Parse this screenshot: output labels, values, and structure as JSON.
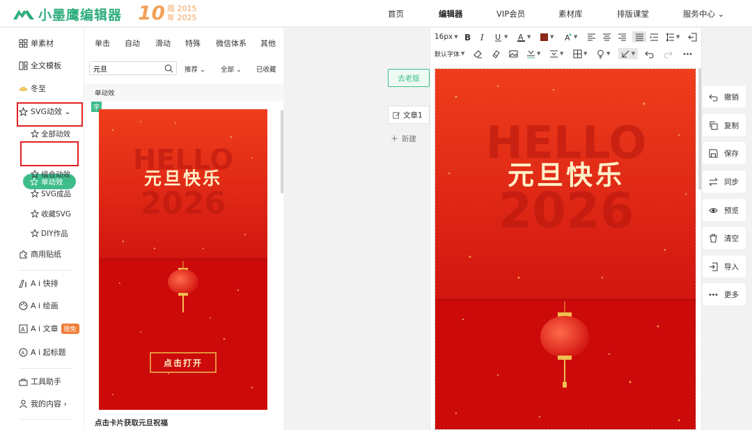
{
  "header": {
    "brand": "小墨鹰编辑器",
    "anniv_number": "10",
    "anniv_line1": "周 2015",
    "anniv_line2": "年 2025",
    "nav": [
      {
        "label": "首页"
      },
      {
        "label": "编辑器"
      },
      {
        "label": "VIP会员"
      },
      {
        "label": "素材库"
      },
      {
        "label": "排版课堂"
      },
      {
        "label": "服务中心 ⌄"
      }
    ]
  },
  "sidebar": {
    "items": [
      {
        "label": "单素材"
      },
      {
        "label": "全文模板"
      },
      {
        "label": "冬至"
      },
      {
        "label": "SVG动效 ⌄"
      },
      {
        "label": "商用贴纸"
      },
      {
        "label": "A i 快排"
      },
      {
        "label": "A i 绘画"
      },
      {
        "label": "A i 文章"
      },
      {
        "label": "A i 起标题"
      },
      {
        "label": "工具助手"
      },
      {
        "label": "我的内容 ›"
      }
    ],
    "badge_free": "限免",
    "sub_items": [
      {
        "label": "全部动效"
      },
      {
        "label": "单动效"
      },
      {
        "label": "组合动效"
      },
      {
        "label": "SVG成品"
      },
      {
        "label": "收藏SVG"
      },
      {
        "label": "DIY作品"
      }
    ]
  },
  "panel": {
    "tabs": [
      {
        "label": "单击"
      },
      {
        "label": "自动"
      },
      {
        "label": "滑动"
      },
      {
        "label": "特殊"
      },
      {
        "label": "微信体系"
      },
      {
        "label": "其他"
      }
    ],
    "search_value": "元旦",
    "filters": [
      {
        "label": "推荐 ⌄"
      },
      {
        "label": "全部 ⌄"
      },
      {
        "label": "已收藏"
      }
    ],
    "section_label": "单动效",
    "card_tag": "字",
    "card_caption": "点击卡片获取元旦祝福",
    "card": {
      "bg_text_hello": "HELLO",
      "bg_text_year": "2026",
      "greeting": "元旦快乐",
      "button": "点击打开"
    }
  },
  "workspace": {
    "go_old": "去老版",
    "doc_tab": "文章1",
    "new_doc": "新建"
  },
  "editor": {
    "font_size": "16px",
    "font_family": "默认字体",
    "canvas": {
      "bg_text_hello": "HELLO",
      "bg_text_year": "2026",
      "greeting": "元旦快乐"
    }
  },
  "actions": [
    {
      "label": "撤销"
    },
    {
      "label": "复制"
    },
    {
      "label": "保存"
    },
    {
      "label": "同步"
    },
    {
      "label": "预览"
    },
    {
      "label": "清空"
    },
    {
      "label": "导入"
    },
    {
      "label": "更多"
    }
  ],
  "colors": {
    "brand_green": "#3dbd8a",
    "card_red_top": "#e8321a",
    "card_red_bottom": "#c8000a",
    "greeting_gold": "#fff0c8"
  }
}
